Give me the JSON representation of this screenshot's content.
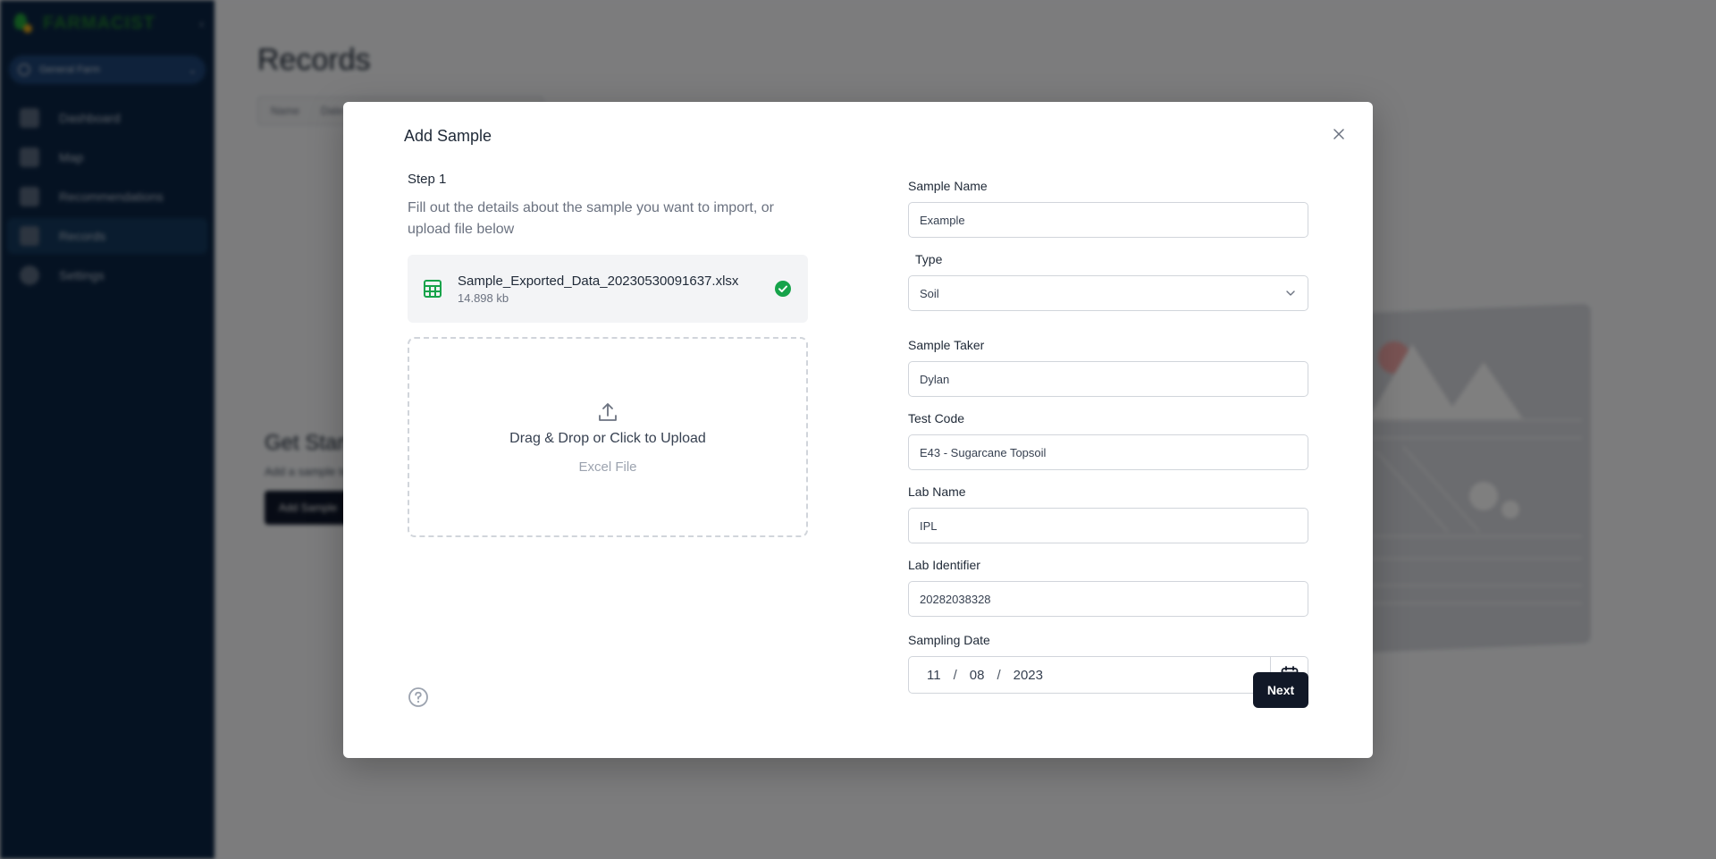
{
  "app": {
    "brand": "FARMACIST",
    "farm_selector": "General Farm",
    "sidebar": {
      "items": [
        {
          "label": "Dashboard",
          "icon": "dashboard-icon",
          "active": false
        },
        {
          "label": "Map",
          "icon": "map-icon",
          "active": false
        },
        {
          "label": "Recommendations",
          "icon": "recommendations-icon",
          "active": false
        },
        {
          "label": "Records",
          "icon": "records-icon",
          "active": true
        },
        {
          "label": "Settings",
          "icon": "settings-icon",
          "active": false
        }
      ]
    },
    "page": {
      "title": "Records",
      "tabs": [
        "Name",
        "Date"
      ],
      "empty_state": {
        "title": "Get Started",
        "subtitle": "Add a sample to get started",
        "button": "Add Sample"
      }
    }
  },
  "modal": {
    "title": "Add Sample",
    "close_icon": "close-icon",
    "step_label": "Step 1",
    "step_description": "Fill out the details about the sample you want to import, or upload file below",
    "uploaded_file": {
      "name": "Sample_Exported_Data_20230530091637.xlsx",
      "size": "14.898 kb",
      "icon": "spreadsheet-icon",
      "status_icon": "check-circle-icon",
      "status_color": "#16a34a"
    },
    "dropzone": {
      "icon": "upload-icon",
      "title": "Drag & Drop or Click to Upload",
      "subtitle": "Excel File"
    },
    "help_icon": "help-circle-icon",
    "form": {
      "sample_name": {
        "label": "Sample Name",
        "value": "Example"
      },
      "type": {
        "label": "Type",
        "value": "Soil"
      },
      "sample_taker": {
        "label": "Sample Taker",
        "value": "Dylan"
      },
      "test_code": {
        "label": "Test Code",
        "value": "E43 - Sugarcane Topsoil"
      },
      "lab_name": {
        "label": "Lab Name",
        "value": "IPL"
      },
      "lab_identifier": {
        "label": "Lab Identifier",
        "value": "20282038328"
      },
      "sampling_date": {
        "label": "Sampling Date",
        "day": "11",
        "month": "08",
        "year": "2023",
        "separator": "/"
      }
    },
    "next_label": "Next"
  }
}
